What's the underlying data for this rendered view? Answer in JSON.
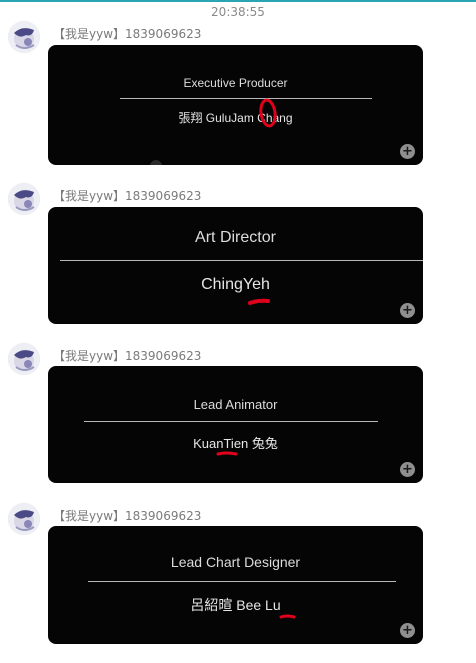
{
  "timestamp": "20:38:55",
  "messages": [
    {
      "sender": "【我是yyw】1839069623",
      "role": "Executive Producer",
      "name": "張翔 GuluJam Chang"
    },
    {
      "sender": "【我是yyw】1839069623",
      "role": "Art Director",
      "name": "ChingYeh"
    },
    {
      "sender": "【我是yyw】1839069623",
      "role": "Lead Animator",
      "name": "KuanTien 兔兔"
    },
    {
      "sender": "【我是yyw】1839069623",
      "role": "Lead Chart Designer",
      "name": "呂紹暄 Bee Lu"
    }
  ],
  "icons": {
    "zoom": "zoom-in-icon",
    "avatar": "avatar-image"
  },
  "colors": {
    "accent_line": "#2aa5b4",
    "annotation_red": "#e0001b",
    "card_bg": "#050505"
  }
}
